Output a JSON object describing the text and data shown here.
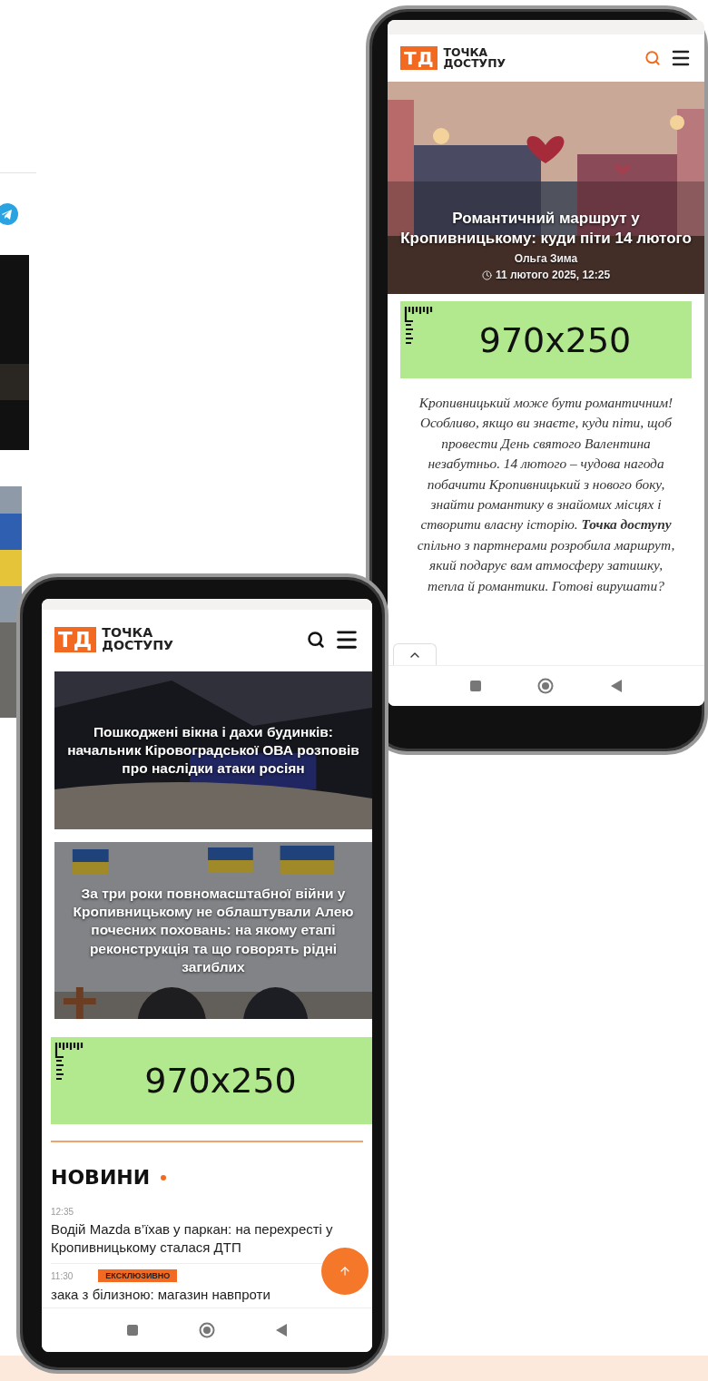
{
  "article_phone": {
    "logo": {
      "mark": "ТД",
      "line1": "ТОЧКА",
      "line2": "ДОСТУПУ"
    },
    "hero": {
      "title": "Романтичний маршрут у Кропивницькому: куди піти 14 лютого",
      "author": "Ольга Зима",
      "date": "11 лютого 2025, 12:25"
    },
    "ad": {
      "label": "970x250"
    },
    "lead": "Кропивницький може бути романтичним! Особливо, якщо ви знаєте, куди піти, щоб провести День святого Валентина незабутньо. 14 лютого – чудова нагода побачити Кропивницький з нового боку, знайти романтику в знайомих місцях і створити власну історію. **Точка доступу** спільно з партнерами розробила маршрут, який подарує вам атмосферу затишку, тепла й романтики. Готові вирушати?"
  },
  "feed_phone": {
    "logo": {
      "mark": "ТД",
      "line1": "ТОЧКА",
      "line2": "ДОСТУПУ"
    },
    "cards": [
      {
        "kind": "night",
        "title": "Пошкоджені вікна і дахи будинків: начальник Кіровоградської ОВА розповів про наслідки атаки росіян"
      },
      {
        "kind": "flags",
        "title": "За три роки повномасштабної війни у Кропивницькому не облаштували Алею почесних поховань: на якому етапі реконструкція та що говорять рідні загиблих"
      }
    ],
    "ad": {
      "label": "970x250"
    },
    "section_title": "НОВИНИ",
    "news": [
      {
        "time": "12:35",
        "title": "Водій Mazda в’їхав у паркан: на перехресті у Кропивницькому сталася ДТП"
      },
      {
        "time": "11:30",
        "badge": "ЕКСКЛЮЗИВНО",
        "title": "зака з білизною: магазин навпроти"
      }
    ]
  }
}
